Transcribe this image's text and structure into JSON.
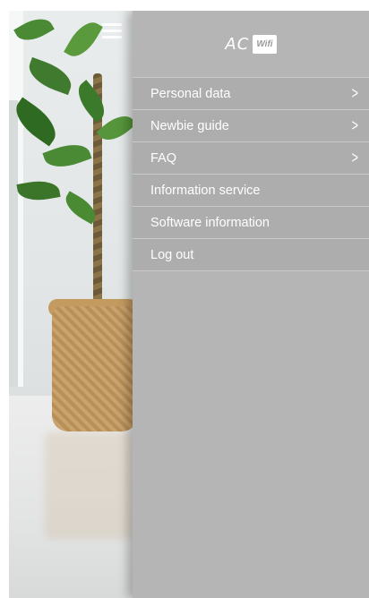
{
  "header": {
    "logo_text": "AC",
    "logo_badge": "Wifi"
  },
  "menu": {
    "items": [
      {
        "label": "Personal data",
        "has_chevron": true
      },
      {
        "label": "Newbie guide",
        "has_chevron": true
      },
      {
        "label": "FAQ",
        "has_chevron": true
      },
      {
        "label": "Information service",
        "has_chevron": false
      },
      {
        "label": "Software information",
        "has_chevron": false
      },
      {
        "label": "Log out",
        "has_chevron": false
      }
    ],
    "chevron_glyph": ">"
  },
  "icons": {
    "menu_toggle": "hamburger-menu-icon",
    "chevron": "chevron-right-icon"
  },
  "colors": {
    "drawer_bg": "#b5b5b5",
    "item_bg": "#adadad",
    "text": "#ffffff"
  }
}
